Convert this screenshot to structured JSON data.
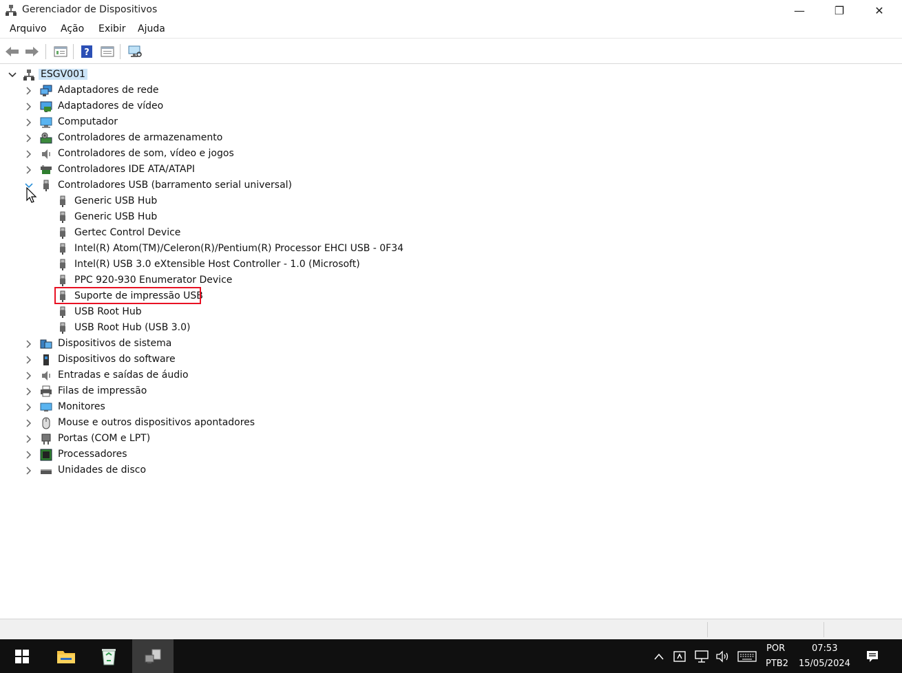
{
  "window": {
    "title": "Gerenciador de Dispositivos",
    "minimize_glyph": "—",
    "maximize_glyph": "❐",
    "close_glyph": "✕"
  },
  "menu": [
    "Arquivo",
    "Ação",
    "Exibir",
    "Ajuda"
  ],
  "toolbar": {
    "icons": [
      "back-icon",
      "forward-icon",
      "properties-view-icon",
      "help-icon",
      "details-view-icon",
      "monitor-scan-icon"
    ]
  },
  "tree": {
    "root": "ESGV001",
    "categories": [
      {
        "label": "Adaptadores de rede",
        "icon": "network-adapter-icon",
        "expanded": false
      },
      {
        "label": "Adaptadores de vídeo",
        "icon": "display-adapter-icon",
        "expanded": false
      },
      {
        "label": "Computador",
        "icon": "computer-icon",
        "expanded": false
      },
      {
        "label": "Controladores de armazenamento",
        "icon": "storage-controller-icon",
        "expanded": false
      },
      {
        "label": "Controladores de som, vídeo e jogos",
        "icon": "sound-icon",
        "expanded": false
      },
      {
        "label": "Controladores IDE ATA/ATAPI",
        "icon": "ide-icon",
        "expanded": false
      },
      {
        "label": "Controladores USB (barramento serial universal)",
        "icon": "usb-icon",
        "expanded": true,
        "children": [
          "Generic USB Hub",
          "Generic USB Hub",
          "Gertec Control Device",
          "Intel(R) Atom(TM)/Celeron(R)/Pentium(R) Processor EHCI USB - 0F34",
          "Intel(R) USB 3.0 eXtensible Host Controller - 1.0 (Microsoft)",
          "PPC 920-930 Enumerator Device",
          "Suporte de impressão USB",
          "USB Root Hub",
          "USB Root Hub (USB 3.0)"
        ]
      },
      {
        "label": "Dispositivos de sistema",
        "icon": "system-devices-icon",
        "expanded": false
      },
      {
        "label": "Dispositivos do software",
        "icon": "software-device-icon",
        "expanded": false
      },
      {
        "label": "Entradas e saídas de áudio",
        "icon": "audio-io-icon",
        "expanded": false
      },
      {
        "label": "Filas de impressão",
        "icon": "print-queue-icon",
        "expanded": false
      },
      {
        "label": "Monitores",
        "icon": "monitor-icon",
        "expanded": false
      },
      {
        "label": "Mouse e outros dispositivos apontadores",
        "icon": "mouse-icon",
        "expanded": false
      },
      {
        "label": "Portas (COM e LPT)",
        "icon": "port-icon",
        "expanded": false
      },
      {
        "label": "Processadores",
        "icon": "processor-icon",
        "expanded": false
      },
      {
        "label": "Unidades de disco",
        "icon": "disk-drive-icon",
        "expanded": false
      }
    ],
    "highlighted_item": "Suporte de impressão USB",
    "highlight_color": "#e81123"
  },
  "taskbar": {
    "apps": [
      "start-icon",
      "file-explorer-icon",
      "recycle-bin-icon",
      "device-manager-icon"
    ],
    "tray": {
      "language_top": "POR",
      "language_bottom": "PTB2",
      "time": "07:53",
      "date": "15/05/2024"
    }
  },
  "colors": {
    "selection": "#cce4f7",
    "taskbar": "#101010",
    "accent": "#0078d7"
  }
}
